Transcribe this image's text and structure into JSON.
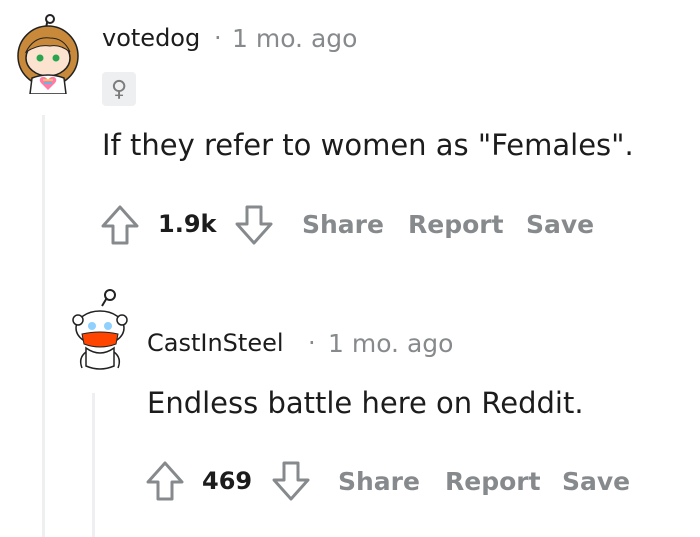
{
  "comment": {
    "username": "votedog",
    "separator": "·",
    "time": "1 mo. ago",
    "flair_icon": "female-symbol",
    "flair_glyph": "♀",
    "body": "If they refer to women as \"Females\".",
    "score": "1.9k",
    "actions": {
      "share": "Share",
      "report": "Report",
      "save": "Save"
    }
  },
  "reply": {
    "username": "CastInSteel",
    "separator": "·",
    "time": "1 mo. ago",
    "body": "Endless battle here on Reddit.",
    "score": "469",
    "actions": {
      "share": "Share",
      "report": "Report",
      "save": "Save"
    }
  },
  "colors": {
    "text": "#1c1c1c",
    "muted": "#878a8c",
    "thread_line": "#edeff1",
    "avatar_hair": "#c8893a",
    "snoo_mask": "#ff4500"
  }
}
